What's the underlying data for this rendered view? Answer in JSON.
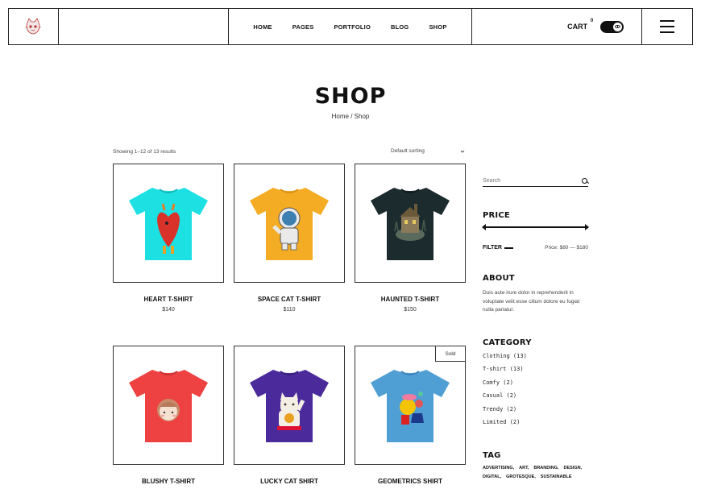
{
  "colors": {
    "border": "#222222",
    "text": "#111111",
    "muted": "#444444",
    "background": "#ffffff"
  },
  "header": {
    "logo_icon": "cat-mascot-logo",
    "nav": [
      "HOME",
      "PAGES",
      "PORTFOLIO",
      "BLOG",
      "SHOP"
    ],
    "cart_label": "CART",
    "cart_count": "0",
    "toggle_icon": "eye-icon",
    "menu_icon": "hamburger-icon"
  },
  "page": {
    "title": "SHOP",
    "breadcrumb": {
      "home": "Home",
      "separator": "/",
      "current": "Shop"
    }
  },
  "toolbar": {
    "result_count": "Showing 1–12 of 13 results",
    "sorting": "Default sorting",
    "sorting_icon": "chevron-down-icon"
  },
  "products": [
    {
      "name": "HEART T-SHIRT",
      "price": "$140",
      "shirt_color": "#1de0e3",
      "graphic": "heart",
      "sold": ""
    },
    {
      "name": "SPACE CAT T-SHIRT",
      "price": "$110",
      "shirt_color": "#f5ac25",
      "graphic": "astronaut-cat",
      "sold": ""
    },
    {
      "name": "HAUNTED T-SHIRT",
      "price": "$150",
      "shirt_color": "#1c2b2e",
      "graphic": "haunted-house",
      "sold": ""
    },
    {
      "name": "BLUSHY T-SHIRT",
      "price": "",
      "shirt_color": "#ee4142",
      "graphic": "blushy-girl",
      "sold": ""
    },
    {
      "name": "LUCKY CAT SHIRT",
      "price": "",
      "shirt_color": "#4b2b9b",
      "graphic": "lucky-cat",
      "sold": ""
    },
    {
      "name": "GEOMETRICS SHIRT",
      "price": "",
      "shirt_color": "#4f9fd4",
      "graphic": "geometric-shapes",
      "sold": "Sold"
    }
  ],
  "sidebar": {
    "search_placeholder": "Search",
    "price_title": "PRICE",
    "filter_label": "FILTER",
    "price_range_text": "Price: $80 — $180",
    "about_title": "ABOUT",
    "about_text": "Duis aute irure dolor in reprehenderit in voluptate velit esse cillum dolore eu fugiat nulla pariatur.",
    "category_title": "CATEGORY",
    "categories": [
      "Clothing (13)",
      "T-shirt (13)",
      "Comfy (2)",
      "Casual (2)",
      "Trendy (2)",
      "Limited (2)"
    ],
    "tag_title": "TAG",
    "tags": [
      "ADVERTISING,",
      "ART,",
      "BRANDING,",
      "DESIGN,",
      "DIGITAL,",
      "GROTESQUE,",
      "SUSTAINABLE"
    ]
  }
}
